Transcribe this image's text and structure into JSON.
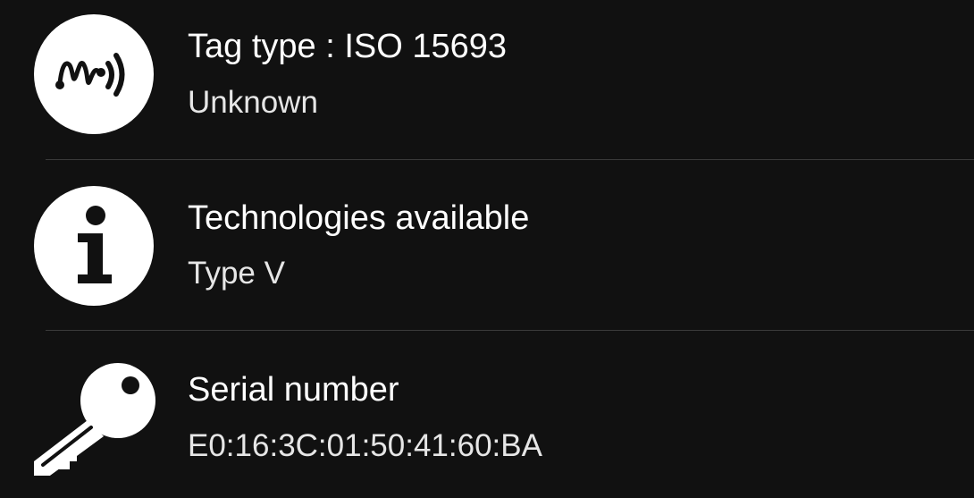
{
  "items": [
    {
      "icon": "nfc-tag-icon",
      "title": "Tag type : ISO 15693",
      "subtitle": "Unknown"
    },
    {
      "icon": "info-icon",
      "title": "Technologies available",
      "subtitle": "Type V"
    },
    {
      "icon": "key-icon",
      "title": "Serial number",
      "subtitle": "E0:16:3C:01:50:41:60:BA"
    }
  ],
  "colors": {
    "background": "#111111",
    "text": "#ffffff",
    "divider": "#3a3a3a"
  }
}
